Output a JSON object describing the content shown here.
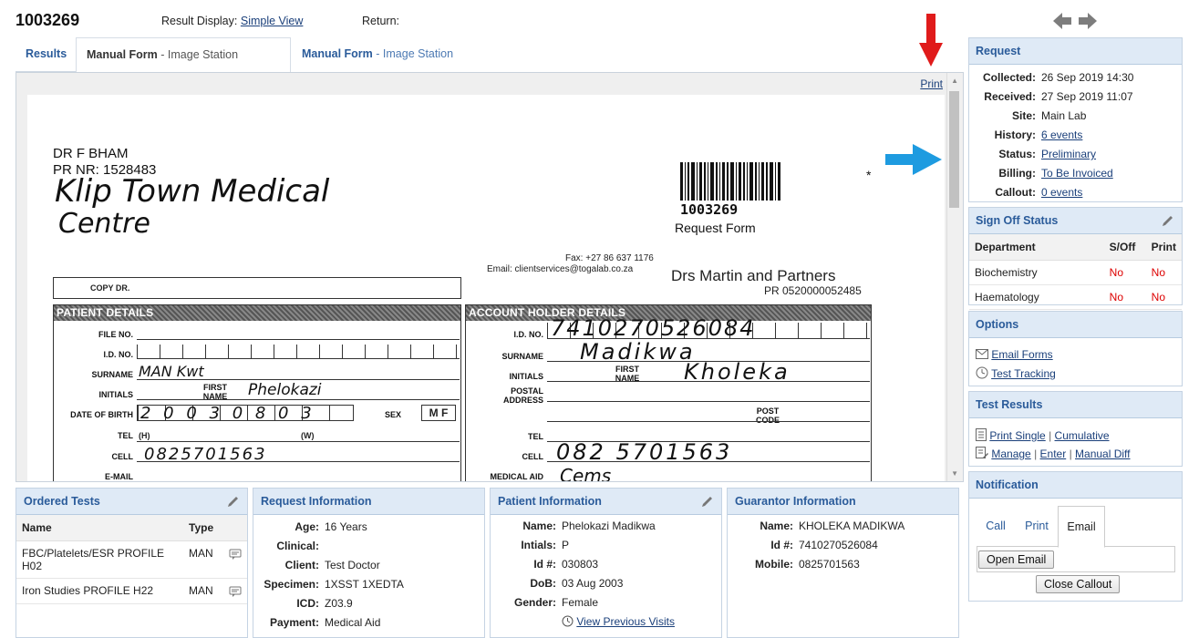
{
  "header": {
    "request_id": "1003269",
    "result_display_label": "Result Display:",
    "result_display_value": "Simple View",
    "return_label": "Return:"
  },
  "tabs": [
    {
      "label": "Results"
    },
    {
      "label": "Manual Form",
      "sub": " - Image Station"
    },
    {
      "label": "Manual Form",
      "sub": " - Image Station"
    }
  ],
  "viewer": {
    "print_label": "Print",
    "form": {
      "doctor": "DR F BHAM",
      "pr_nr": "PR NR: 1528483",
      "practice_handwritten_1": "Klip Town Medical",
      "practice_handwritten_2": "Centre",
      "barcode_number": "1003269",
      "request_form": "Request Form",
      "fax": "Fax: +27 86 637 1176",
      "email": "Email: clientservices@togalab.co.za",
      "lab_partner": "Drs Martin and Partners",
      "lab_pr": "PR 0520000052485",
      "copy_dr": "COPY DR.",
      "patient_details_title": "PATIENT DETAILS",
      "account_holder_title": "ACCOUNT HOLDER DETAILS",
      "labels": {
        "file_no": "FILE NO.",
        "id_no": "I.D. NO.",
        "surname": "SURNAME",
        "initials": "INITIALS",
        "first_name": "FIRST NAME",
        "dob": "DATE OF BIRTH",
        "sex": "SEX",
        "tel": "TEL",
        "tel_h": "(H)",
        "tel_w": "(W)",
        "cell": "CELL",
        "email": "E-MAIL",
        "postal_address": "POSTAL ADDRESS",
        "post_code": "POST CODE",
        "medical_aid": "MEDICAL AID"
      },
      "patient": {
        "surname": "MAN Kwt",
        "first_name": "Phelokazi",
        "dob": "2 0 0 3 0 8 0 3",
        "sex": "M F",
        "cell": "0825701563"
      },
      "account": {
        "id_no": "7410270526084",
        "surname": "Madikwa",
        "first_name": "Kholeka",
        "cell": "082 5701563",
        "medical_aid": "Cems"
      }
    }
  },
  "ordered_tests": {
    "title": "Ordered Tests",
    "columns": [
      "Name",
      "Type"
    ],
    "rows": [
      {
        "name": "FBC/Platelets/ESR PROFILE H02",
        "type": "MAN"
      },
      {
        "name": "Iron Studies PROFILE H22",
        "type": "MAN"
      }
    ]
  },
  "request_information": {
    "title": "Request Information",
    "fields": [
      {
        "label": "Age:",
        "value": "16 Years"
      },
      {
        "label": "Clinical:",
        "value": ""
      },
      {
        "label": "Client:",
        "value": "Test Doctor"
      },
      {
        "label": "Specimen:",
        "value": "1XSST 1XEDTA"
      },
      {
        "label": "ICD:",
        "value": "Z03.9"
      },
      {
        "label": "Payment:",
        "value": "Medical Aid"
      }
    ]
  },
  "patient_information": {
    "title": "Patient Information",
    "fields": [
      {
        "label": "Name:",
        "value": "Phelokazi Madikwa"
      },
      {
        "label": "Intials:",
        "value": "P"
      },
      {
        "label": "Id #:",
        "value": "030803"
      },
      {
        "label": "DoB:",
        "value": "03 Aug 2003"
      },
      {
        "label": "Gender:",
        "value": "Female"
      }
    ],
    "view_previous_visits": "View Previous Visits"
  },
  "guarantor_information": {
    "title": "Guarantor Information",
    "fields": [
      {
        "label": "Name:",
        "value": "KHOLEKA MADIKWA"
      },
      {
        "label": "Id #:",
        "value": "7410270526084"
      },
      {
        "label": "Mobile:",
        "value": "0825701563"
      }
    ]
  },
  "request_panel": {
    "title": "Request",
    "fields": [
      {
        "label": "Collected:",
        "value": "26 Sep 2019 14:30"
      },
      {
        "label": "Received:",
        "value": "27 Sep 2019 11:07"
      },
      {
        "label": "Site:",
        "value": "Main Lab"
      },
      {
        "label": "History:",
        "value": "6 events"
      },
      {
        "label": "Status:",
        "value": "Preliminary"
      },
      {
        "label": "Billing:",
        "value": "To Be Invoiced"
      },
      {
        "label": "Callout:",
        "value": "0 events"
      }
    ]
  },
  "sign_off_status": {
    "title": "Sign Off Status",
    "columns": [
      "Department",
      "S/Off",
      "Print"
    ],
    "rows": [
      {
        "department": "Biochemistry",
        "soff": "No",
        "print": "No"
      },
      {
        "department": "Haematology",
        "soff": "No",
        "print": "No"
      }
    ]
  },
  "options": {
    "title": "Options",
    "email_forms": "Email Forms",
    "test_tracking": "Test Tracking"
  },
  "test_results": {
    "title": "Test Results",
    "print_single": "Print Single",
    "cumulative": "Cumulative",
    "manage": "Manage",
    "enter": "Enter",
    "manual_diff": "Manual Diff"
  },
  "notification": {
    "title": "Notification",
    "tabs": [
      "Call",
      "Print",
      "Email"
    ],
    "open_email": "Open Email",
    "close_callout": "Close Callout"
  },
  "colors": {
    "accent": "#2a5b9a",
    "panel_header": "#dfeaf6",
    "red_arrow": "#e01b1b",
    "blue_arrow": "#1e9be0",
    "no_status": "#dd0000"
  }
}
